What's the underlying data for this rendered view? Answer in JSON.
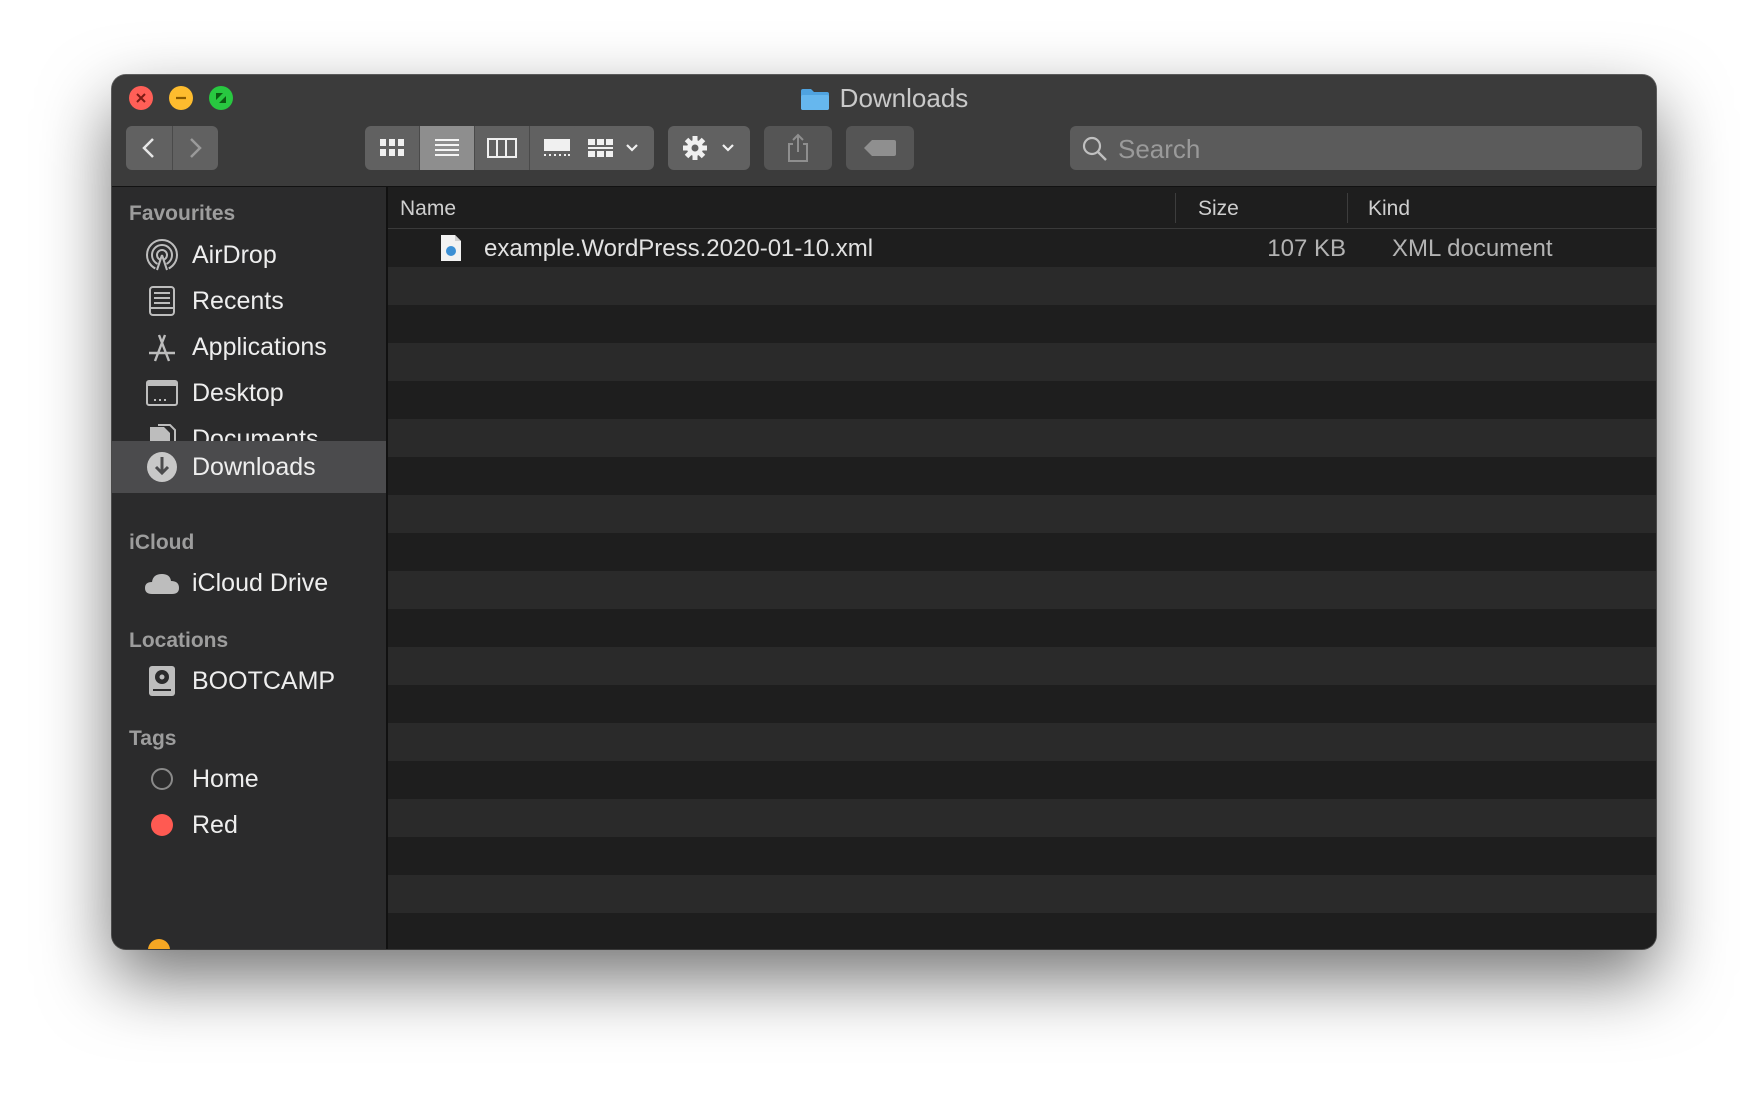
{
  "window": {
    "title": "Downloads"
  },
  "toolbar": {
    "back_icon": "chevron-left-icon",
    "forward_icon": "chevron-right-icon",
    "view_modes": [
      "icon-view",
      "list-view",
      "column-view",
      "gallery-view"
    ],
    "active_view": "list-view",
    "group_icon": "group-by-icon",
    "action_icon": "gear-icon",
    "share_icon": "share-icon",
    "tag_icon": "tag-icon",
    "search": {
      "placeholder": "Search",
      "value": ""
    }
  },
  "sidebar": {
    "sections": [
      {
        "title": "Favourites",
        "items": [
          {
            "label": "AirDrop",
            "icon": "airdrop-icon"
          },
          {
            "label": "Recents",
            "icon": "recents-icon"
          },
          {
            "label": "Applications",
            "icon": "applications-icon"
          },
          {
            "label": "Desktop",
            "icon": "desktop-icon"
          },
          {
            "label": "Documents",
            "icon": "documents-icon"
          },
          {
            "label": "Downloads",
            "icon": "downloads-icon",
            "selected": true
          }
        ]
      },
      {
        "title": "iCloud",
        "items": [
          {
            "label": "iCloud Drive",
            "icon": "cloud-icon"
          }
        ]
      },
      {
        "title": "Locations",
        "items": [
          {
            "label": "BOOTCAMP",
            "icon": "disk-icon"
          }
        ]
      },
      {
        "title": "Tags",
        "items": [
          {
            "label": "Home",
            "icon": "tag-circle-empty",
            "color": ""
          },
          {
            "label": "Red",
            "icon": "tag-circle",
            "color": "#ff5a52"
          }
        ]
      }
    ]
  },
  "list": {
    "columns": [
      "Name",
      "Size",
      "Kind"
    ],
    "rows": [
      {
        "name": "example.WordPress.2020-01-10.xml",
        "size": "107 KB",
        "kind": "XML document",
        "icon": "xml-file-icon"
      }
    ]
  },
  "colors": {
    "accent_folder": "#4fa3e0",
    "tag_red": "#ff5a52",
    "close": "#ff5f57",
    "minimize": "#febc2e",
    "maximize": "#28c840"
  }
}
